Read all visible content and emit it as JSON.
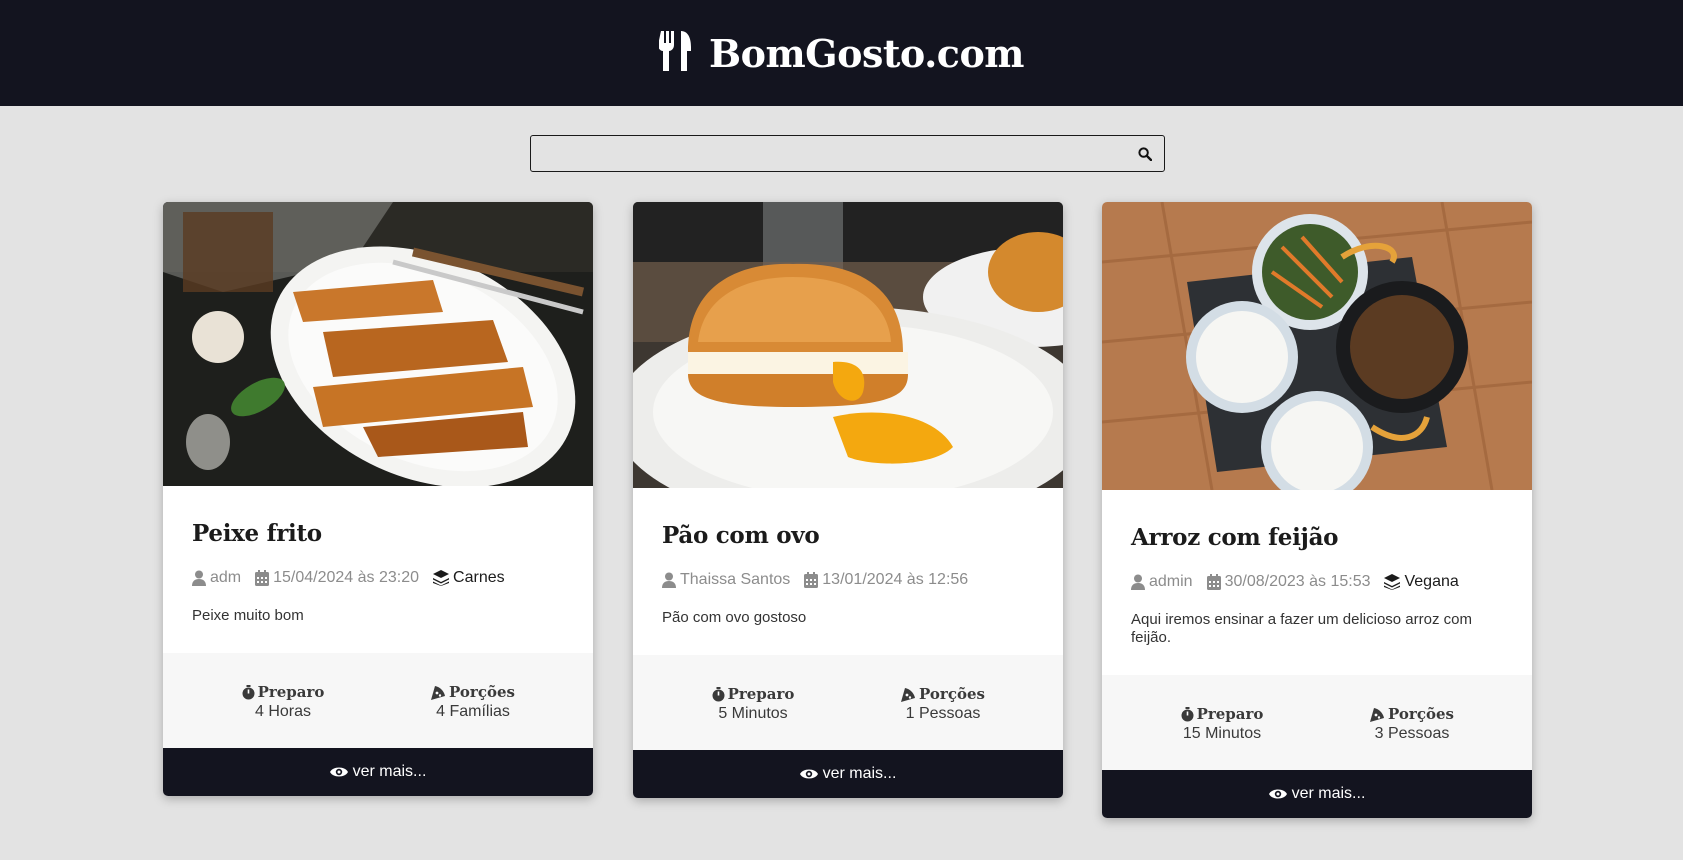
{
  "header": {
    "brand": "BomGosto.com"
  },
  "search": {
    "value": "",
    "placeholder": ""
  },
  "labels": {
    "preparo": "Preparo",
    "porcoes": "Porções",
    "ver_mais": "ver mais..."
  },
  "colors": {
    "header_bg": "#13141f",
    "page_bg": "#e3e3e3",
    "stats_bg": "#f7f7f7"
  },
  "cards": [
    {
      "title": "Peixe frito",
      "author": "adm",
      "date": "15/04/2024 às 23:20",
      "category": "Carnes",
      "description": "Peixe muito bom",
      "preparo": "4 Horas",
      "porcoes": "4 Famílias",
      "image_alt": "Peixe frito"
    },
    {
      "title": "Pão com ovo",
      "author": "Thaissa Santos",
      "date": "13/01/2024 às 12:56",
      "category": "",
      "description": "Pão com ovo gostoso",
      "preparo": "5 Minutos",
      "porcoes": "1 Pessoas",
      "image_alt": "Pão com ovo"
    },
    {
      "title": "Arroz com feijão",
      "author": "admin",
      "date": "30/08/2023 às 15:53",
      "category": "Vegana",
      "description": "Aqui iremos ensinar a fazer um delicioso arroz com feijão.",
      "preparo": "15 Minutos",
      "porcoes": "3 Pessoas",
      "image_alt": "Arroz com feijão"
    }
  ]
}
